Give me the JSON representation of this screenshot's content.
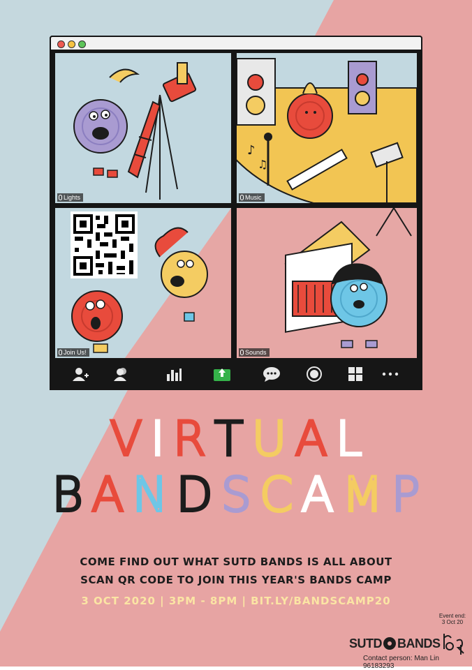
{
  "colors": {
    "bg_blue": "#c5d8de",
    "bg_pink": "#e7a4a3",
    "tile_blue": "#c2d8e0",
    "tile_pink": "#e6a7a5",
    "stage_yellow": "#f2c553",
    "red": "#e84b3c",
    "purple": "#a99bd1",
    "yellow": "#f4cc62",
    "light_blue": "#6ec6e6",
    "cream": "#fbe5a4"
  },
  "window": {
    "tiles": [
      {
        "label": "Lights"
      },
      {
        "label": "Music"
      },
      {
        "label": "Join Us!"
      },
      {
        "label": "Sounds"
      }
    ],
    "toolbar": [
      {
        "icon": "add-participant-icon"
      },
      {
        "icon": "participants-icon"
      },
      {
        "icon": "poll-chart-icon"
      },
      {
        "icon": "share-screen-icon"
      },
      {
        "icon": "chat-icon"
      },
      {
        "icon": "record-icon"
      },
      {
        "icon": "gallery-view-icon"
      },
      {
        "icon": "more-icon"
      }
    ]
  },
  "title": {
    "line1": [
      {
        "char": "V",
        "color": "#e84b3c"
      },
      {
        "char": "I",
        "color": "#ffffff"
      },
      {
        "char": "R",
        "color": "#e84b3c"
      },
      {
        "char": "T",
        "color": "#1c1c1c"
      },
      {
        "char": "U",
        "color": "#f4cc62"
      },
      {
        "char": "A",
        "color": "#e84b3c"
      },
      {
        "char": "L",
        "color": "#ffffff"
      }
    ],
    "line2": [
      {
        "char": "B",
        "color": "#1c1c1c"
      },
      {
        "char": "A",
        "color": "#e84b3c"
      },
      {
        "char": "N",
        "color": "#6ec6e6"
      },
      {
        "char": "D",
        "color": "#1c1c1c"
      },
      {
        "char": "S",
        "color": "#a99bd1"
      },
      {
        "char": "C",
        "color": "#f4cc62"
      },
      {
        "char": "A",
        "color": "#ffffff"
      },
      {
        "char": "M",
        "color": "#f4cc62"
      },
      {
        "char": "P",
        "color": "#a99bd1"
      }
    ]
  },
  "info": {
    "line1": "COME FIND OUT WHAT SUTD BANDS IS ALL ABOUT",
    "line2": "SCAN QR CODE TO JOIN THIS YEAR'S BANDS CAMP",
    "line3": "3 OCT 2020 |  3PM - 8PM  | BIT.LY/BANDSCAMP20"
  },
  "footer": {
    "logo_text": "SUTD",
    "logo_text2": "BANDS",
    "event_end_label": "Event end:",
    "event_end_date": "3 Oct 20",
    "contact": "Contact person: Man Lin 96183293"
  }
}
